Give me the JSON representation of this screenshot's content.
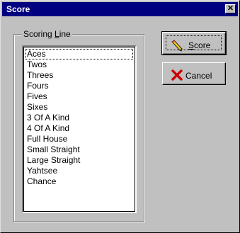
{
  "window": {
    "title": "Score"
  },
  "group": {
    "legend_pre": "Scoring ",
    "legend_accel": "L",
    "legend_post": "ine"
  },
  "list": {
    "items": [
      "Aces",
      "Twos",
      "Threes",
      "Fours",
      "Fives",
      "Sixes",
      "3 Of A Kind",
      "4 Of A Kind",
      "Full House",
      "Small Straight",
      "Large Straight",
      "Yahtsee",
      "Chance"
    ],
    "focused_index": 0
  },
  "buttons": {
    "score": {
      "accel": "S",
      "rest": "core",
      "icon": "pencil-icon"
    },
    "cancel": {
      "label": "Cancel",
      "icon": "red-x-icon"
    }
  },
  "colors": {
    "titlebar": "#000080",
    "face": "#c0c0c0",
    "cancel_x": "#cc0000"
  }
}
